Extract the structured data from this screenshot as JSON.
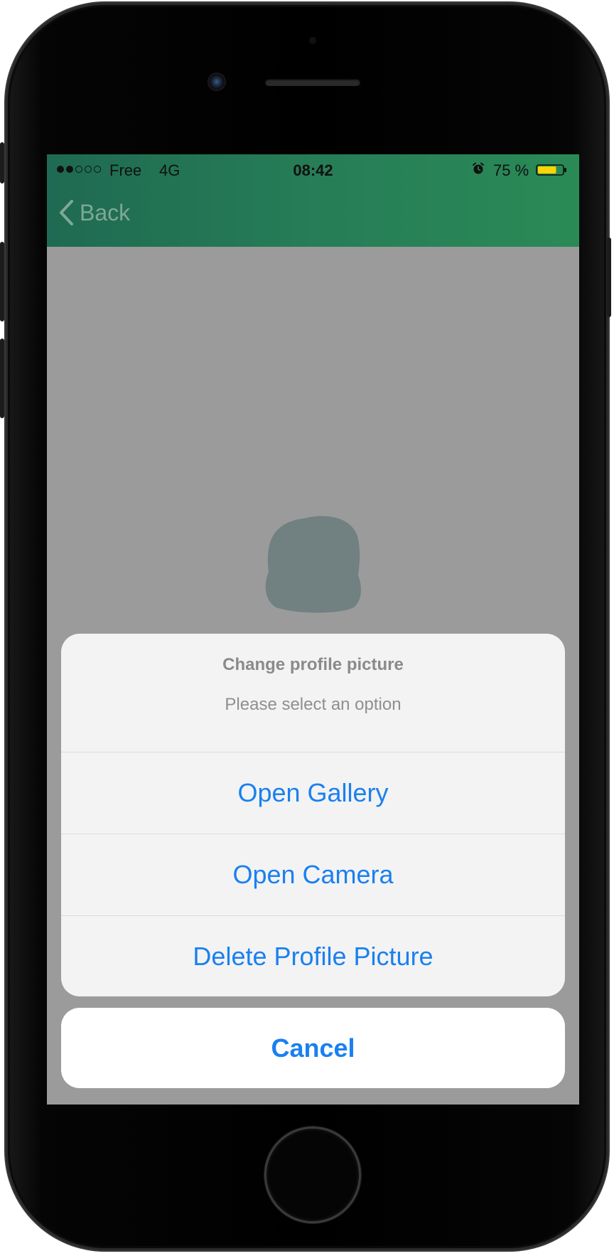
{
  "status_bar": {
    "signal_filled": 2,
    "signal_empty": 3,
    "carrier": "Free",
    "network": "4G",
    "time": "08:42",
    "battery_percent": "75 %",
    "battery_level": 0.75,
    "battery_color": "#ffd400"
  },
  "nav": {
    "back_label": "Back",
    "header_color": "#267d57"
  },
  "action_sheet": {
    "title": "Change profile picture",
    "subtitle": "Please select an option",
    "options": [
      {
        "label": "Open Gallery"
      },
      {
        "label": "Open Camera"
      },
      {
        "label": "Delete Profile Picture"
      }
    ],
    "cancel_label": "Cancel",
    "accent_color": "#1a80f0"
  },
  "icons": {
    "back": "chevron-left-icon",
    "alarm": "alarm-icon",
    "battery": "battery-icon",
    "avatar": "avatar-silhouette-icon"
  }
}
